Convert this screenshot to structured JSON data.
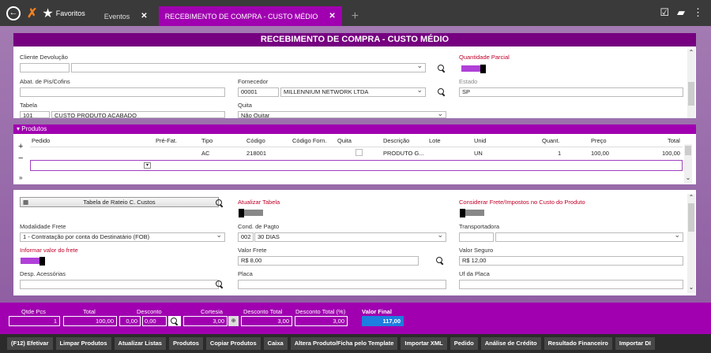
{
  "topbar": {
    "favorites_label": "Favoritos",
    "tabs": [
      {
        "label": "Eventos"
      },
      {
        "label": "RECEBIMENTO DE COMPRA - CUSTO MÉDIO"
      }
    ],
    "close_glyph": "✕",
    "add_glyph": "+"
  },
  "header": {
    "title": "RECEBIMENTO DE COMPRA - CUSTO MÉDIO"
  },
  "form": {
    "cliente_devolucao_label": "Cliente Devolução",
    "quantidade_parcial_label": "Quantidade Parcial",
    "abat_label": "Abat. de Pis/Cofins",
    "fornecedor_label": "Fornecedor",
    "fornecedor_code": "00001",
    "fornecedor_name": "MILLENNIUM NETWORK LTDA",
    "estado_label": "Estado",
    "estado_value": "SP",
    "tabela_label": "Tabela",
    "tabela_code": "101",
    "tabela_name": "CUSTO PRODUTO ACABADO",
    "quita_label": "Quita",
    "quita_value": "Não Quitar"
  },
  "produtos": {
    "section_label": "Produtos",
    "columns": [
      "Pedido",
      "Pré-Fat.",
      "Tipo",
      "Código",
      "Código Forn.",
      "Quita",
      "Descrição",
      "Lote",
      "Unid",
      "Quant.",
      "Preço",
      "Total"
    ],
    "row": {
      "tipo": "AC",
      "codigo": "218001",
      "descricao": "PRODUTO G...",
      "unid": "UN",
      "quant": "1",
      "preco": "100,00",
      "total": "100,00"
    }
  },
  "lower": {
    "rateio_button": "Tabela de Rateio C. Custos",
    "atualizar_tabela_label": "Atualizar Tabela",
    "considerar_frete_label": "Considerar Frete/Impostos no Custo do Produto",
    "modalidade_frete_label": "Modalidade Frete",
    "modalidade_frete_value": "1 - Contratação por conta do Destinatário (FOB)",
    "cond_pagto_label": "Cond. de Pagto",
    "cond_pagto_code": "002",
    "cond_pagto_name": "30 DIAS",
    "transportadora_label": "Transportadora",
    "informar_valor_frete_label": "Informar valor do frete",
    "valor_frete_label": "Valor Frete",
    "valor_frete_value": "R$ 8,00",
    "valor_seguro_label": "Valor Seguro",
    "valor_seguro_value": "R$ 12,00",
    "desp_acessorias_label": "Desp. Acessórias",
    "placa_label": "Placa",
    "uf_placa_label": "Uf da Placa"
  },
  "totals": {
    "qtde_pcs_label": "Qtde Pcs",
    "qtde_pcs_value": "1",
    "total_label": "Total",
    "total_value": "100,00",
    "desconto_label": "Desconto",
    "desconto_value1": "0,00",
    "desconto_value2": "0,00",
    "cortesia_label": "Cortesia",
    "cortesia_value": "3,00",
    "desconto_total_label": "Desconto Total",
    "desconto_total_value": "3,00",
    "desconto_total_pct_label": "Desconto Total (%)",
    "desconto_total_pct_value": "3,00",
    "valor_final_label": "Valor Final",
    "valor_final_value": "117,00"
  },
  "actions": [
    "(F12) Efetivar",
    "Limpar Produtos",
    "Atualizar Listas",
    "Produtos",
    "Copiar Produtos",
    "Caixa",
    "Altera Produto/Ficha pelo Template",
    "Importar XML",
    "Pedido",
    "Análise de Crédito",
    "Resultado Financeiro",
    "Importar DI"
  ],
  "colors": {
    "accent": "#a000b0",
    "header": "#760080",
    "final": "#1e7de0"
  }
}
